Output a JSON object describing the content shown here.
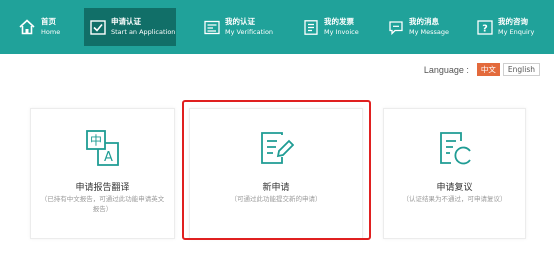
{
  "nav": {
    "items": [
      {
        "zh": "首页",
        "en": "Home",
        "icon": "home-icon"
      },
      {
        "zh": "申请认证",
        "en": "Start an Application",
        "icon": "application-icon"
      },
      {
        "zh": "我的认证",
        "en": "My Verification",
        "icon": "verification-icon"
      },
      {
        "zh": "我的发票",
        "en": "My Invoice",
        "icon": "invoice-icon"
      },
      {
        "zh": "我的消息",
        "en": "My Message",
        "icon": "message-icon"
      },
      {
        "zh": "我的咨询",
        "en": "My Enquiry",
        "icon": "enquiry-icon"
      }
    ],
    "active_index": 1
  },
  "language": {
    "label": "Language :",
    "options": [
      "中文",
      "English"
    ],
    "selected": "中文"
  },
  "cards": [
    {
      "title": "申请报告翻译",
      "subtitle": "（已持有中文报告，可通过此功能申请英文报告）",
      "icon": "translate-icon"
    },
    {
      "title": "新申请",
      "subtitle": "（可通过此功能提交新的申请）",
      "icon": "edit-document-icon"
    },
    {
      "title": "申请复议",
      "subtitle": "（认证结果为不通过，可申请复议）",
      "icon": "reconsider-icon"
    }
  ],
  "colors": {
    "nav_bg": "#20a29a",
    "nav_active": "#116f68",
    "icon_teal": "#1f9c94",
    "lang_active": "#e36a3c",
    "highlight_border": "#e02020"
  }
}
